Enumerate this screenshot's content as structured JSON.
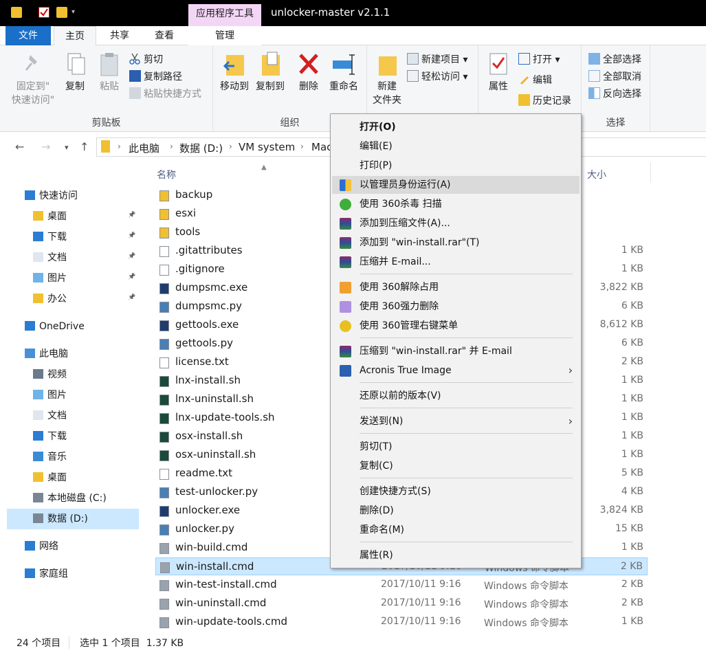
{
  "window": {
    "title": "unlocker-master v2.1.1",
    "context_tab": "应用程序工具"
  },
  "tabs": {
    "file": "文件",
    "home": "主页",
    "share": "共享",
    "view": "查看",
    "manage": "管理"
  },
  "ribbon": {
    "clipboard": {
      "group": "剪贴板",
      "pin_line1": "固定到\"",
      "pin_line2": "快速访问\"",
      "copy": "复制",
      "paste": "粘贴",
      "cut": "剪切",
      "copy_path": "复制路径",
      "paste_shortcut": "粘贴快捷方式"
    },
    "organize": {
      "group": "组织",
      "move_to": "移动到",
      "copy_to": "复制到",
      "delete": "删除",
      "rename": "重命名"
    },
    "new": {
      "new_folder_line1": "新建",
      "new_folder_line2": "文件夹",
      "new_item": "新建项目",
      "easy_access": "轻松访问"
    },
    "open": {
      "properties": "属性",
      "open": "打开",
      "edit": "编辑",
      "history": "历史记录"
    },
    "select": {
      "group": "选择",
      "select_all": "全部选择",
      "select_none": "全部取消",
      "invert": "反向选择"
    }
  },
  "address": {
    "crumbs": [
      "此电脑",
      "数据 (D:)",
      "VM system",
      "Mac"
    ]
  },
  "columns": {
    "name": "名称",
    "size": "大小"
  },
  "nav": {
    "quick_access": "快速访问",
    "desktop": "桌面",
    "downloads": "下载",
    "documents": "文档",
    "pictures": "图片",
    "office": "办公",
    "onedrive": "OneDrive",
    "this_pc": "此电脑",
    "videos": "视频",
    "pictures2": "图片",
    "documents2": "文档",
    "downloads2": "下载",
    "music": "音乐",
    "desktop2": "桌面",
    "local_c": "本地磁盘 (C:)",
    "data_d": "数据 (D:)",
    "network": "网络",
    "homegroup": "家庭组"
  },
  "files": [
    {
      "name": "backup",
      "date": "",
      "type": "",
      "size": ""
    },
    {
      "name": "esxi",
      "date": "",
      "type": "",
      "size": ""
    },
    {
      "name": "tools",
      "date": "",
      "type": "",
      "size": ""
    },
    {
      "name": ".gitattributes",
      "date": "",
      "type": "",
      "size": "1 KB"
    },
    {
      "name": ".gitignore",
      "date": "",
      "type": "",
      "size": "1 KB"
    },
    {
      "name": "dumpsmc.exe",
      "date": "",
      "type": "",
      "size": "3,822 KB"
    },
    {
      "name": "dumpsmc.py",
      "date": "",
      "type": "",
      "size": "6 KB"
    },
    {
      "name": "gettools.exe",
      "date": "",
      "type": "",
      "size": "8,612 KB"
    },
    {
      "name": "gettools.py",
      "date": "",
      "type": "",
      "size": "6 KB"
    },
    {
      "name": "license.txt",
      "date": "",
      "type": "",
      "size": "2 KB"
    },
    {
      "name": "lnx-install.sh",
      "date": "",
      "type": "",
      "size": "1 KB"
    },
    {
      "name": "lnx-uninstall.sh",
      "date": "",
      "type": "",
      "size": "1 KB"
    },
    {
      "name": "lnx-update-tools.sh",
      "date": "",
      "type": "",
      "size": "1 KB"
    },
    {
      "name": "osx-install.sh",
      "date": "",
      "type": "",
      "size": "1 KB"
    },
    {
      "name": "osx-uninstall.sh",
      "date": "",
      "type": "",
      "size": "1 KB"
    },
    {
      "name": "readme.txt",
      "date": "",
      "type": "",
      "size": "5 KB"
    },
    {
      "name": "test-unlocker.py",
      "date": "",
      "type": "",
      "size": "4 KB"
    },
    {
      "name": "unlocker.exe",
      "date": "",
      "type": "",
      "size": "3,824 KB"
    },
    {
      "name": "unlocker.py",
      "date": "",
      "type": "",
      "size": "15 KB"
    },
    {
      "name": "win-build.cmd",
      "date": "",
      "type": "",
      "size": "1 KB"
    },
    {
      "name": "win-install.cmd",
      "date": "2017/10/11 9:16",
      "type": "Windows 命令脚本",
      "size": "2 KB"
    },
    {
      "name": "win-test-install.cmd",
      "date": "2017/10/11 9:16",
      "type": "Windows 命令脚本",
      "size": "2 KB"
    },
    {
      "name": "win-uninstall.cmd",
      "date": "2017/10/11 9:16",
      "type": "Windows 命令脚本",
      "size": "2 KB"
    },
    {
      "name": "win-update-tools.cmd",
      "date": "2017/10/11 9:16",
      "type": "Windows 命令脚本",
      "size": "1 KB"
    }
  ],
  "status": {
    "count": "24 个项目",
    "selection": "选中 1 个项目  1.37 KB"
  },
  "context_menu": {
    "open": "打开(O)",
    "edit": "编辑(E)",
    "print": "打印(P)",
    "run_as_admin": "以管理员身份运行(A)",
    "scan_360": "使用 360杀毒 扫描",
    "add_archive": "添加到压缩文件(A)...",
    "add_rar": "添加到 \"win-install.rar\"(T)",
    "compress_email": "压缩并 E-mail...",
    "unlock_360": "使用 360解除占用",
    "force_delete_360": "使用 360强力删除",
    "manage_menu_360": "使用 360管理右键菜单",
    "compress_rar_email": "压缩到 \"win-install.rar\" 并 E-mail",
    "acronis": "Acronis True Image",
    "restore_prev": "还原以前的版本(V)",
    "send_to": "发送到(N)",
    "cut": "剪切(T)",
    "copy": "复制(C)",
    "create_shortcut": "创建快捷方式(S)",
    "delete": "删除(D)",
    "rename": "重命名(M)",
    "properties": "属性(R)"
  }
}
